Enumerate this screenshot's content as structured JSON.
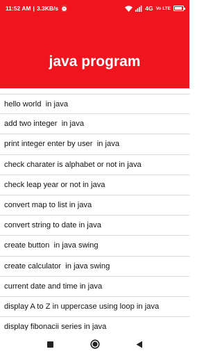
{
  "status_bar": {
    "time": "11:52 AM",
    "speed": "3.3KB/s",
    "network": "4G",
    "network_badges": "Vo LTE",
    "battery_level": 0.9
  },
  "header": {
    "title": "java program"
  },
  "list": {
    "items": [
      "hello world  in java",
      "add two integer  in java",
      "print integer enter by user  in java",
      "check charater is alphabet or not in java",
      "check leap year or not in java",
      "convert map to list in java",
      "convert string to date in java",
      "create button  in java swing",
      "create calculator  in java swing",
      "current date and time in java",
      "display A to Z in uppercase using loop in java",
      "display fibonacii series in java"
    ]
  },
  "nav": {
    "recents": "recents-square-icon",
    "home": "home-circle-icon",
    "back": "back-triangle-icon"
  }
}
